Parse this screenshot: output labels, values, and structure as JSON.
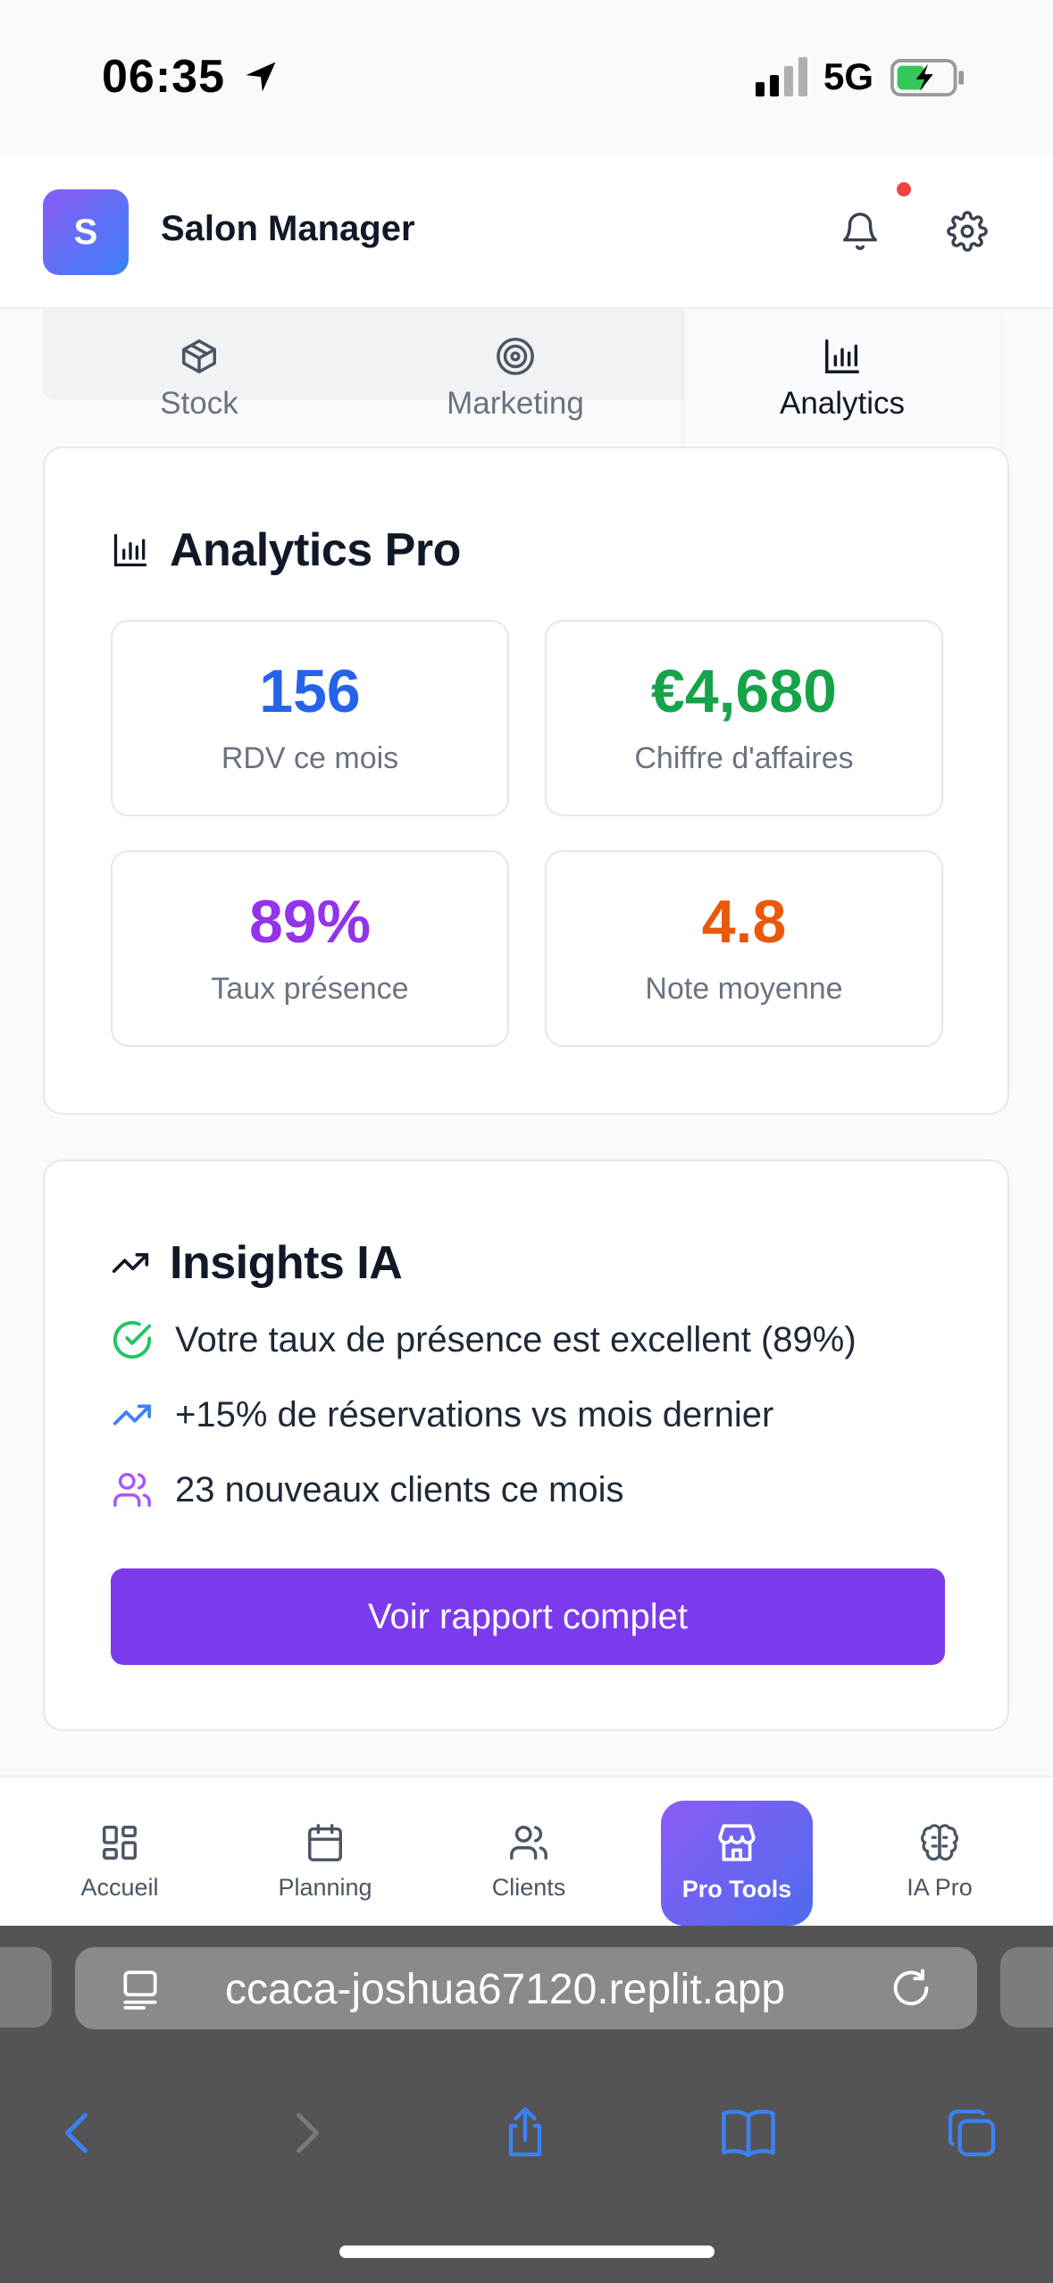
{
  "status_bar": {
    "time": "06:35",
    "network": "5G"
  },
  "header": {
    "logo_letter": "S",
    "title": "Salon Manager"
  },
  "tabs": [
    {
      "label": "Stock",
      "icon": "box-icon"
    },
    {
      "label": "Marketing",
      "icon": "target-icon"
    },
    {
      "label": "Analytics",
      "icon": "bar-chart-icon",
      "active": true
    }
  ],
  "analytics": {
    "title": "Analytics Pro",
    "stats": [
      {
        "value": "156",
        "label": "RDV ce mois",
        "color": "#2563eb"
      },
      {
        "value": "€4,680",
        "label": "Chiffre d'affaires",
        "color": "#16a34a"
      },
      {
        "value": "89%",
        "label": "Taux présence",
        "color": "#9333ea"
      },
      {
        "value": "4.8",
        "label": "Note moyenne",
        "color": "#ea580c"
      }
    ]
  },
  "insights": {
    "title": "Insights IA",
    "items": [
      {
        "text": "Votre taux de présence est excellent (89%)",
        "icon": "check-circle-icon",
        "color": "#22c55e"
      },
      {
        "text": "+15% de réservations vs mois dernier",
        "icon": "trending-up-icon",
        "color": "#3b82f6"
      },
      {
        "text": "23 nouveaux clients ce mois",
        "icon": "users-icon",
        "color": "#a855f7"
      }
    ],
    "button_label": "Voir rapport complet"
  },
  "bottom_nav": [
    {
      "label": "Accueil",
      "icon": "grid-icon"
    },
    {
      "label": "Planning",
      "icon": "calendar-icon"
    },
    {
      "label": "Clients",
      "icon": "users-icon"
    },
    {
      "label": "Pro Tools",
      "icon": "store-icon",
      "active": true
    },
    {
      "label": "IA Pro",
      "icon": "brain-icon"
    }
  ],
  "browser": {
    "url": "ccaca-joshua67120.replit.app"
  },
  "colors": {
    "accent": "#7c3aed",
    "brand_gradient_start": "#8b5cf6",
    "brand_gradient_end": "#3b82f6"
  }
}
